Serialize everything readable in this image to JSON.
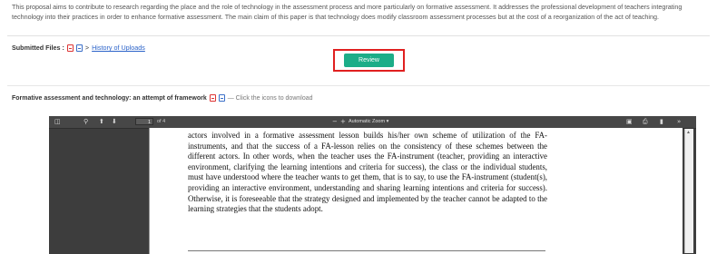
{
  "abstract": "This proposal aims to contribute to research regarding the place and the role of technology in the assessment process and more particularly on formative assessment. It addresses the professional development of teachers integrating technology into their practices in order to enhance formative assessment. The main claim of this paper is that technology does modify classroom assessment processes but at the cost of a reorganization of the act of teaching.",
  "files": {
    "label": "Submitted Files :",
    "sep": ">",
    "history_link": "History of Uploads"
  },
  "review": {
    "label": "Review"
  },
  "attachment": {
    "title": "Formative assessment and technology: an attempt of framework",
    "hint": "— Click the icons to download"
  },
  "viewer": {
    "page_number": "1",
    "page_total": "of 4",
    "zoom_minus": "−",
    "zoom_plus": "+",
    "zoom_label": "Automatic Zoom",
    "more": "»",
    "page_text": "actors involved in a formative assessment lesson builds his/her own scheme of utilization of the FA-instruments, and that the success of a FA-lesson relies on the consistency of these schemes between the different actors. In other words, when the teacher uses the FA-instrument (teacher, providing an interactive environment, clarifying the learning intentions and criteria for success), the class or the individual students, must have understood where the teacher wants to get them, that is to say, to use the FA-instrument (student(s), providing an interactive environment, understanding and sharing learning intentions and criteria for success). Otherwise, it is foreseeable that the strategy designed and implemented by the teacher cannot be adapted to the learning strategies that the students adopt."
  },
  "colors": {
    "review_button": "#1cad88",
    "highlight_border": "#e02020",
    "link": "#2a62c9"
  }
}
